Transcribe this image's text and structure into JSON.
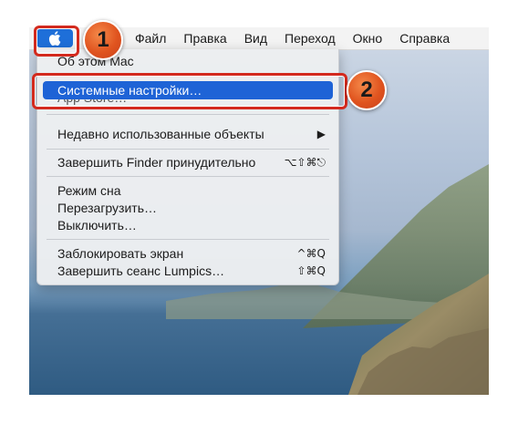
{
  "menubar": {
    "items": [
      "Файл",
      "Правка",
      "Вид",
      "Переход",
      "Окно",
      "Справка"
    ]
  },
  "apple_menu": {
    "items": [
      {
        "label": "Об этом Mac",
        "shortcut": ""
      },
      {
        "label": "Системные настройки…",
        "shortcut": "",
        "highlighted": true
      },
      {
        "label": "App Store…",
        "shortcut": ""
      },
      {
        "label": "Недавно использованные объекты",
        "shortcut": "▶"
      },
      {
        "label": "Завершить Finder принудительно",
        "shortcut": "⌥⇧⌘⎋"
      },
      {
        "label": "Режим сна",
        "shortcut": ""
      },
      {
        "label": "Перезагрузить…",
        "shortcut": ""
      },
      {
        "label": "Выключить…",
        "shortcut": ""
      },
      {
        "label": "Заблокировать экран",
        "shortcut": "^⌘Q"
      },
      {
        "label": "Завершить сеанс Lumpics…",
        "shortcut": "⇧⌘Q"
      }
    ]
  },
  "annotations": {
    "badge1": "1",
    "badge2": "2"
  },
  "colors": {
    "highlight": "#1e63d6",
    "callout": "#d32a1e"
  }
}
